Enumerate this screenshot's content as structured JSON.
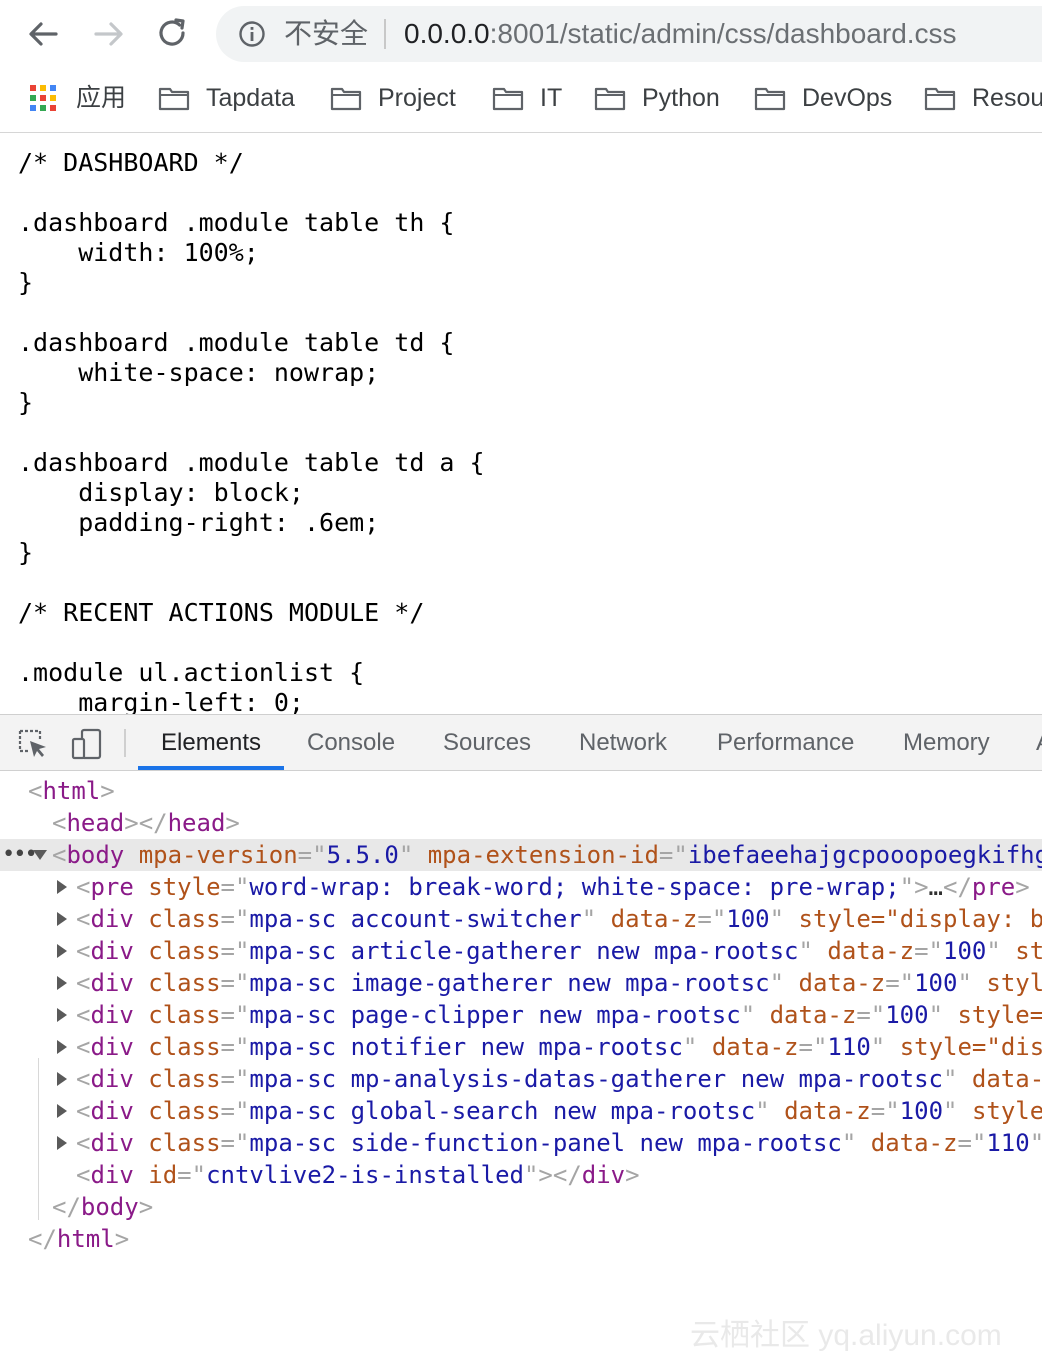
{
  "browser": {
    "security_label": "不安全",
    "url_host": "0.0.0.0",
    "url_rest": ":8001/static/admin/css/dashboard.css",
    "bookmarks": [
      {
        "label": "应用",
        "icon": "apps-grid-icon"
      },
      {
        "label": "Tapdata",
        "icon": "folder-icon"
      },
      {
        "label": "Project",
        "icon": "folder-icon"
      },
      {
        "label": "IT",
        "icon": "folder-icon"
      },
      {
        "label": "Python",
        "icon": "folder-icon"
      },
      {
        "label": "DevOps",
        "icon": "folder-icon"
      },
      {
        "label": "Resou",
        "icon": "folder-icon"
      }
    ]
  },
  "page": {
    "source_text": "/* DASHBOARD */\n\n.dashboard .module table th {\n    width: 100%;\n}\n\n.dashboard .module table td {\n    white-space: nowrap;\n}\n\n.dashboard .module table td a {\n    display: block;\n    padding-right: .6em;\n}\n\n/* RECENT ACTIONS MODULE */\n\n.module ul.actionlist {\n    margin-left: 0;"
  },
  "devtools": {
    "tabs": [
      "Elements",
      "Console",
      "Sources",
      "Network",
      "Performance",
      "Memory"
    ],
    "active_tab": "Elements",
    "overflow_glyph": "A",
    "dom": {
      "html_open": "html",
      "head_tag": "head",
      "body": {
        "tag": "body",
        "attr1_name": "mpa-version",
        "attr1_value": "5.5.0",
        "attr2_name": "mpa-extension-id",
        "attr2_value": "ibefaeehajgcpooopoegkifhg"
      },
      "pre_row": {
        "tag": "pre",
        "attr_name": "style",
        "attr_value": "word-wrap: break-word; white-space: pre-wrap;",
        "collapsed": "…",
        "close": "pre"
      },
      "div_rows": [
        {
          "class": "mpa-sc account-switcher",
          "z_name": "data-z",
          "z": "100",
          "tail": "style=\"display: b"
        },
        {
          "class": "mpa-sc article-gatherer new mpa-rootsc",
          "z_name": "data-z",
          "z": "100",
          "tail": "st"
        },
        {
          "class": "mpa-sc image-gatherer new mpa-rootsc",
          "z_name": "data-z",
          "z": "100",
          "tail": "styl"
        },
        {
          "class": "mpa-sc page-clipper new mpa-rootsc",
          "z_name": "data-z",
          "z": "100",
          "tail": "style="
        },
        {
          "class": "mpa-sc notifier new mpa-rootsc",
          "z_name": "data-z",
          "z": "110",
          "tail": "style=\"dis"
        },
        {
          "class": "mpa-sc mp-analysis-datas-gatherer new mpa-rootsc",
          "z_name": "data-",
          "z": "",
          "tail": ""
        },
        {
          "class": "mpa-sc global-search new mpa-rootsc",
          "z_name": "data-z",
          "z": "100",
          "tail": "style"
        },
        {
          "class": "mpa-sc side-function-panel new mpa-rootsc",
          "z_name": "data-z",
          "z": "110",
          "tail": ""
        }
      ],
      "installed_div": {
        "attr_name": "id",
        "attr_value": "cntvlive2-is-installed"
      },
      "body_close": "body",
      "html_close": "html"
    }
  },
  "watermark": "云栖社区 yq.aliyun.com"
}
